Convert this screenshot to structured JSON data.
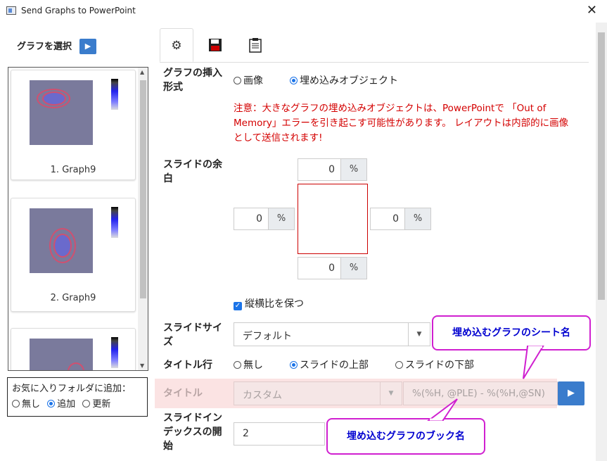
{
  "window": {
    "title": "Send Graphs to PowerPoint"
  },
  "left_panel": {
    "heading": "グラフを選択",
    "graphs": [
      {
        "label": "1. Graph9"
      },
      {
        "label": "2. Graph9"
      }
    ],
    "favorites": {
      "label": "お気に入りフォルダに追加：",
      "options": [
        "無し",
        "追加",
        "更新"
      ],
      "selected": "追加"
    }
  },
  "tabs": [
    {
      "icon": "gear-icon",
      "glyph": "⚙"
    },
    {
      "icon": "save-icon",
      "glyph": "💾"
    },
    {
      "icon": "clipboard-icon",
      "glyph": "📋"
    }
  ],
  "insert_format": {
    "label_line1": "グラフの挿入",
    "label_line2": "形式",
    "options": [
      "画像",
      "埋め込みオブジェクト"
    ],
    "selected": "埋め込みオブジェクト",
    "warning_line1": "注意：大きなグラフの埋め込みオブジェクトは、PowerPointで 「Out of",
    "warning_line2": "Memory」エラーを引き起こす可能性があります。 レイアウトは内部的に画像",
    "warning_line3": "として送信されます!"
  },
  "margins": {
    "label_line1": "スライドの余",
    "label_line2": "白",
    "top": "0",
    "left": "0",
    "right": "0",
    "bottom": "0",
    "unit": "%",
    "keep_aspect_label": "縦横比を保つ",
    "keep_aspect_checked": true
  },
  "slide_size": {
    "label_line1": "スライドサイ",
    "label_line2": "ズ",
    "value": "デフォルト"
  },
  "title_row": {
    "label": "タイトル行",
    "options": [
      "無し",
      "スライドの上部",
      "スライドの下部"
    ],
    "selected": "スライドの上部"
  },
  "title": {
    "label": "タイトル",
    "mode": "カスタム",
    "template": "%(%H, @PLE) - %(%H,@SN)"
  },
  "slide_index": {
    "label_line1": "スライドイン",
    "label_line2": "デックスの開",
    "label_line3": "始",
    "value": "2"
  },
  "callouts": {
    "sheet_name": "埋め込むグラフのシート名",
    "book_name": "埋め込むグラフのブック名"
  },
  "colors": {
    "accent": "#3a7ccc",
    "warning": "#d40000",
    "callout_border": "#d020d0",
    "callout_text": "#0000d0"
  }
}
